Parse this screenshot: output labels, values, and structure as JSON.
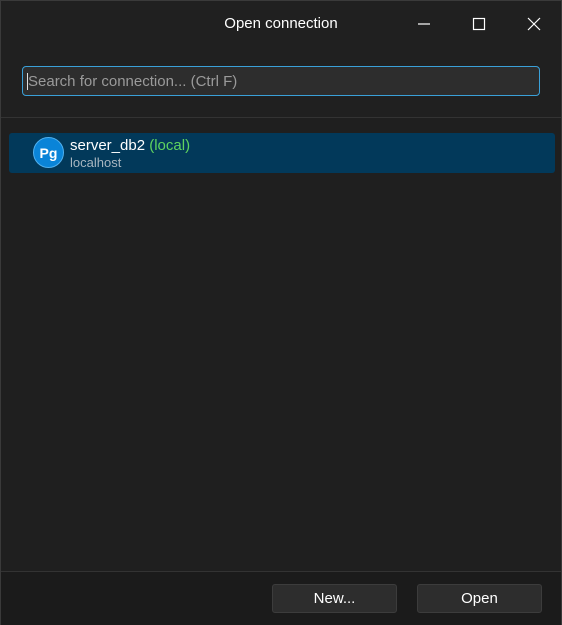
{
  "window": {
    "title": "Open connection"
  },
  "search": {
    "placeholder": "Search for connection... (Ctrl F)",
    "value": ""
  },
  "connections": [
    {
      "name": "server_db2",
      "tag": "(local)",
      "host": "localhost",
      "icon": "postgresql-icon",
      "icon_text": "Pg",
      "selected": true
    }
  ],
  "footer": {
    "new_label": "New...",
    "open_label": "Open"
  },
  "colors": {
    "selection": "#02395a",
    "accent": "#3aa0d8",
    "local_tag": "#5fd35f",
    "pg_icon": "#0a84d8"
  }
}
